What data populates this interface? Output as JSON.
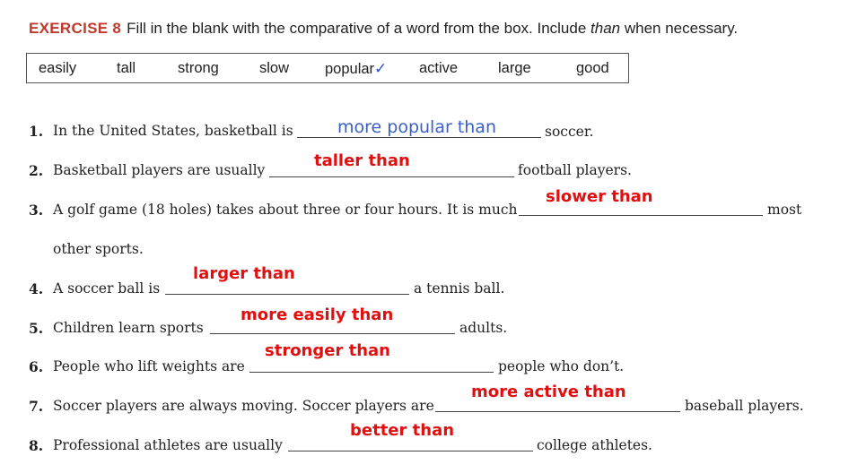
{
  "exercise": {
    "label": "EXERCISE 8",
    "instruction_before": "Fill in the blank with the comparative of a word from the box. Include ",
    "instruction_italic": "than",
    "instruction_after": " when necessary."
  },
  "word_box": [
    "easily",
    "tall",
    "strong",
    "slow",
    "popular",
    "active",
    "large",
    "good"
  ],
  "word_box_check": "✓",
  "items": [
    {
      "num": "1.",
      "before": "In the United States, basketball is",
      "answer": "more popular than",
      "after": "soccer."
    },
    {
      "num": "2.",
      "before": "Basketball players are usually",
      "answer": "taller than",
      "after": "football players."
    },
    {
      "num": "3.",
      "before": "A golf game (18 holes) takes about three or four hours. It is much",
      "answer": "slower than",
      "after": "most",
      "continuation": "other sports."
    },
    {
      "num": "4.",
      "before": "A soccer ball is",
      "answer": "larger than",
      "after": "a tennis ball."
    },
    {
      "num": "5.",
      "before": "Children learn sports",
      "answer": "more easily than",
      "after": "adults."
    },
    {
      "num": "6.",
      "before": "People who lift weights are",
      "answer": "stronger than",
      "after": "people who don’t."
    },
    {
      "num": "7.",
      "before": "Soccer players are always moving. Soccer players are",
      "answer": "more active than",
      "after": "baseball players."
    },
    {
      "num": "8.",
      "before": "Professional athletes are usually",
      "answer": "better than",
      "after": "college athletes."
    }
  ],
  "colors": {
    "heading_accent": "#c0392b",
    "answer_red": "#e01010",
    "handwriting_blue": "#3a5fc8"
  }
}
